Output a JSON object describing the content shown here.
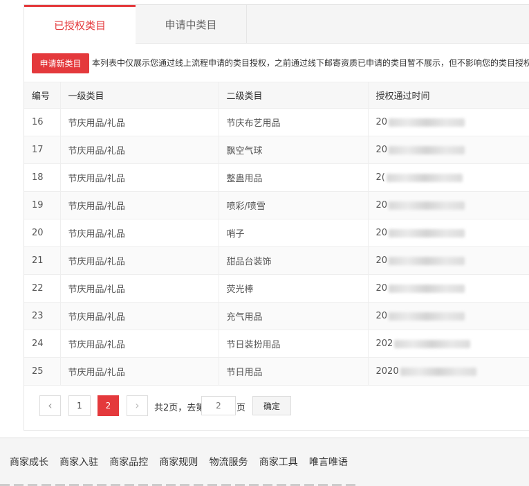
{
  "tabs": [
    {
      "label": "已授权类目",
      "active": true
    },
    {
      "label": "申请中类目",
      "active": false
    }
  ],
  "apply_button": "申请新类目",
  "notice": "本列表中仅展示您通过线上流程申请的类目授权，之前通过线下邮寄资质已申请的类目暂不展示，但不影响您的类目授权",
  "table": {
    "headers": [
      "编号",
      "一级类目",
      "二级类目",
      "授权通过时间"
    ],
    "rows": [
      {
        "id": "16",
        "level1": "节庆用品/礼品",
        "level2": "节庆布艺用品",
        "time": "20"
      },
      {
        "id": "17",
        "level1": "节庆用品/礼品",
        "level2": "飘空气球",
        "time": "20"
      },
      {
        "id": "18",
        "level1": "节庆用品/礼品",
        "level2": "整蛊用品",
        "time": "2("
      },
      {
        "id": "19",
        "level1": "节庆用品/礼品",
        "level2": "喷彩/喷雪",
        "time": "20"
      },
      {
        "id": "20",
        "level1": "节庆用品/礼品",
        "level2": "哨子",
        "time": "20"
      },
      {
        "id": "21",
        "level1": "节庆用品/礼品",
        "level2": "甜品台装饰",
        "time": "20"
      },
      {
        "id": "22",
        "level1": "节庆用品/礼品",
        "level2": "荧光棒",
        "time": "20"
      },
      {
        "id": "23",
        "level1": "节庆用品/礼品",
        "level2": "充气用品",
        "time": "20"
      },
      {
        "id": "24",
        "level1": "节庆用品/礼品",
        "level2": "节日装扮用品",
        "time": "202"
      },
      {
        "id": "25",
        "level1": "节庆用品/礼品",
        "level2": "节日用品",
        "time": "2020"
      }
    ]
  },
  "pagination": {
    "prev_icon": "‹",
    "next_icon": "›",
    "page1": "1",
    "page2": "2",
    "total_text": "共2页，去第",
    "input_placeholder": "2",
    "unit": "页",
    "confirm": "确定",
    "current_page": 2
  },
  "footer": {
    "links": [
      "商家成长",
      "商家入驻",
      "商家品控",
      "商家规则",
      "物流服务",
      "商家工具",
      "唯言唯语"
    ]
  }
}
